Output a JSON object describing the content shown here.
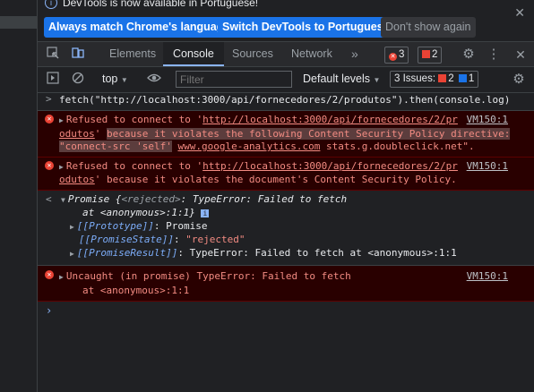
{
  "infobar": {
    "message": "DevTools is now available in Portuguese!",
    "btn_always": "Always match Chrome's language",
    "btn_switch": "Switch DevTools to Portuguese",
    "btn_dont": "Don't show again",
    "close": "✕"
  },
  "tabs": [
    "Elements",
    "Console",
    "Sources",
    "Network"
  ],
  "more_tabs": "»",
  "badges": {
    "errors": "3",
    "warnings": "2"
  },
  "toolbar": {
    "context": "top",
    "filter_placeholder": "Filter",
    "levels": "Default levels",
    "issues_label": "3 Issues:",
    "issues_err": "2",
    "issues_info": "1"
  },
  "console": {
    "input_cmd": "fetch(\"http://localhost:3000/api/fornecedores/2/produtos\").then(console.log)",
    "err1": {
      "prefix": "Refused to connect to '",
      "url_a": "http://localhost:3000/api/fornecedores/2/pr",
      "url_b": "odutos",
      "mid": "' ",
      "reason_a": "because it violates the following Content Security Policy directive:",
      "reason_b": "\"connect-src 'self'",
      "site": "www.google-analytics.com",
      "tail": " stats.g.doubleclick.net\".",
      "loc": "VM150:1"
    },
    "err2": {
      "prefix": "Refused to connect to '",
      "url_a": "http://localhost:3000/api/fornecedores/2/pr",
      "url_b": "odutos",
      "tail": "' because it violates the document's Content Security Policy.",
      "loc": "VM150:1"
    },
    "promise": {
      "head_a": "Promise {",
      "head_state": "<rejected>",
      "head_b": ": TypeError: Failed to fetch",
      "head_c": "at <anonymous>:1:1}",
      "proto_key": "[[Prototype]]",
      "proto_val": "Promise",
      "state_key": "[[PromiseState]]",
      "state_val": "\"rejected\"",
      "result_key": "[[PromiseResult]]",
      "result_val": "TypeError: Failed to fetch at <anonymous>:1:1"
    },
    "err3": {
      "line1": "Uncaught (in promise) TypeError: Failed to fetch",
      "line2": "at <anonymous>:1:1",
      "loc": "VM150:1"
    }
  }
}
